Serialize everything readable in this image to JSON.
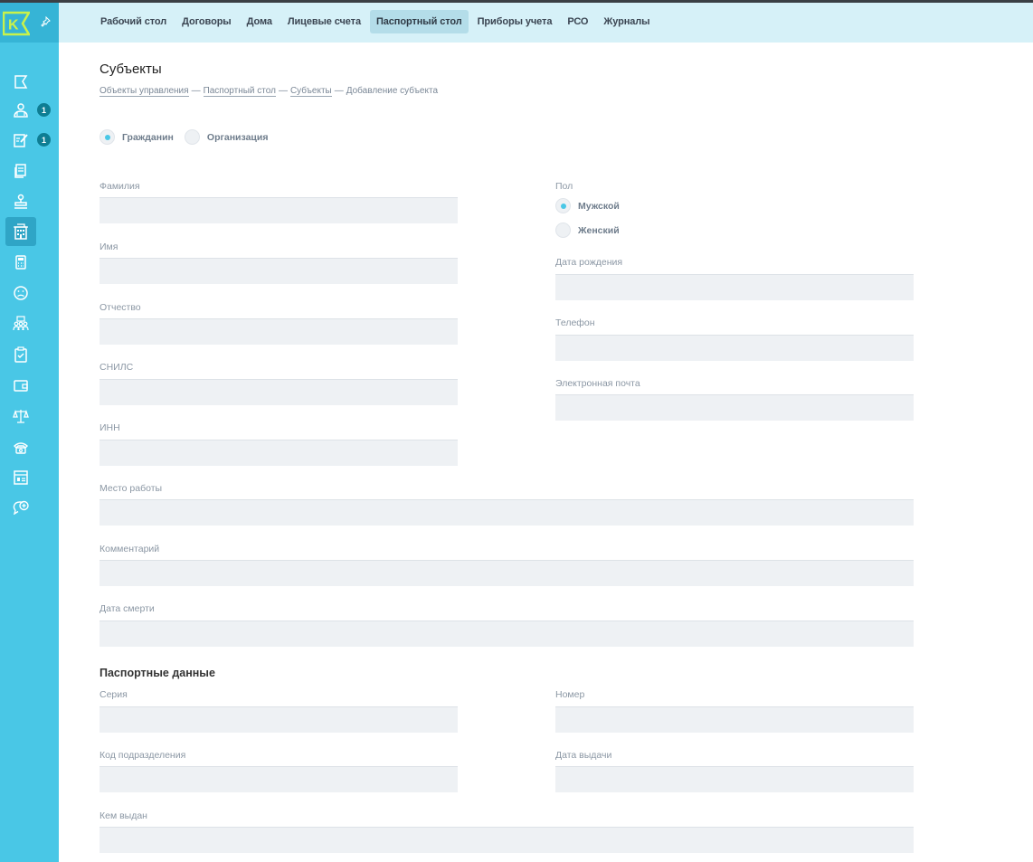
{
  "nav": {
    "items": [
      {
        "label": "Рабочий стол",
        "active": false
      },
      {
        "label": "Договоры",
        "active": false
      },
      {
        "label": "Дома",
        "active": false
      },
      {
        "label": "Лицевые счета",
        "active": false
      },
      {
        "label": "Паспортный стол",
        "active": true
      },
      {
        "label": "Приборы учета",
        "active": false
      },
      {
        "label": "РСО",
        "active": false
      },
      {
        "label": "Журналы",
        "active": false
      }
    ]
  },
  "sidebar": {
    "logo_letter": "K",
    "badges": {
      "citizens": "1",
      "requests": "1"
    },
    "icons": [
      "flag-icon",
      "people-icon",
      "edit-icon",
      "documents-icon",
      "stamp-icon",
      "building-icon",
      "calculator-icon",
      "sad-face-icon",
      "group-icon",
      "clipboard-icon",
      "wallet-icon",
      "scales-icon",
      "phone-icon",
      "dashboard-icon",
      "chat-add-icon"
    ]
  },
  "page": {
    "title": "Субъекты",
    "breadcrumb": [
      "Объекты управления",
      "Паспортный стол",
      "Субъекты",
      "Добавление субъекта"
    ]
  },
  "subject_type": {
    "options": [
      "Гражданин",
      "Организация"
    ],
    "selected": "Гражданин"
  },
  "form": {
    "surname": {
      "label": "Фамилия",
      "value": ""
    },
    "name": {
      "label": "Имя",
      "value": ""
    },
    "patronymic": {
      "label": "Отчество",
      "value": ""
    },
    "snils": {
      "label": "СНИЛС",
      "value": ""
    },
    "inn": {
      "label": "ИНН",
      "value": ""
    },
    "gender": {
      "label": "Пол",
      "options": [
        "Мужской",
        "Женский"
      ],
      "selected": "Мужской"
    },
    "birth_date": {
      "label": "Дата рождения",
      "value": ""
    },
    "phone": {
      "label": "Телефон",
      "value": ""
    },
    "email": {
      "label": "Электронная почта",
      "value": ""
    },
    "workplace": {
      "label": "Место работы",
      "value": ""
    },
    "comment": {
      "label": "Комментарий",
      "value": ""
    },
    "death_date": {
      "label": "Дата смерти",
      "value": ""
    }
  },
  "passport": {
    "title": "Паспортные данные",
    "series": {
      "label": "Серия",
      "value": ""
    },
    "number": {
      "label": "Номер",
      "value": ""
    },
    "division_code": {
      "label": "Код подразделения",
      "value": ""
    },
    "issue_date": {
      "label": "Дата выдачи",
      "value": ""
    },
    "issued_by": {
      "label": "Кем выдан",
      "value": ""
    }
  },
  "colors": {
    "accent": "#49c7e6",
    "sidebar": "#49c7e6",
    "topbar": "#d6f1f8",
    "badge": "#0e7d93"
  }
}
